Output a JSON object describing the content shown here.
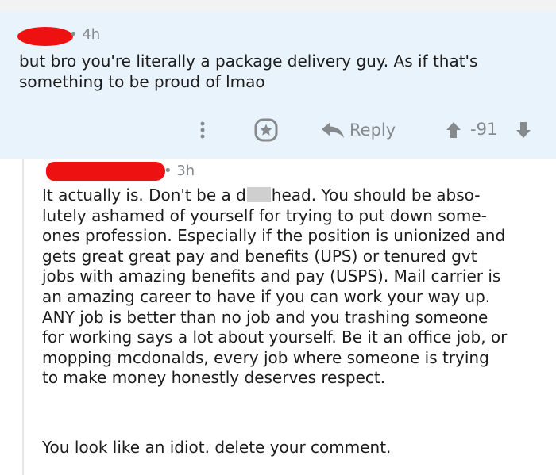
{
  "comment_parent": {
    "time": "4h",
    "body_lines": [
      "but bro you're literally a package delivery guy. As if that's",
      "something to be proud of lmao"
    ]
  },
  "actions": {
    "more_icon": "more-vertical-icon",
    "award_icon": "award-icon",
    "reply_icon": "reply-arrow-icon",
    "reply_label": "Reply",
    "upvote_icon": "upvote-arrow-icon",
    "score": "-91",
    "downvote_icon": "downvote-arrow-icon"
  },
  "comment_reply": {
    "time": "3h",
    "body_line_1_before": "It actually is. Don't be a d",
    "body_line_1_after": "head. You should be abso-",
    "body_lines": [
      "lutely ashamed of yourself for trying to put down some-",
      "ones profession. Especially if the position is unionized and",
      "gets great great pay and benefits (UPS) or tenured gvt",
      "jobs with amazing benefits and pay (USPS). Mail carrier is",
      "an amazing career to have if you can work your way up.",
      "ANY job is better than no job and you trashing someone",
      "for working says a lot about yourself. Be it an office job, or",
      "mopping mcdonalds, every job where someone is trying",
      "to make money honestly deserves respect."
    ],
    "closing_line": "You look like an idiot. delete your comment."
  },
  "colors": {
    "highlight_bg": "#e8f3fc",
    "meta_gray": "#878a8c",
    "redaction_red": "#ee1111",
    "text": "#1c1c1c"
  }
}
